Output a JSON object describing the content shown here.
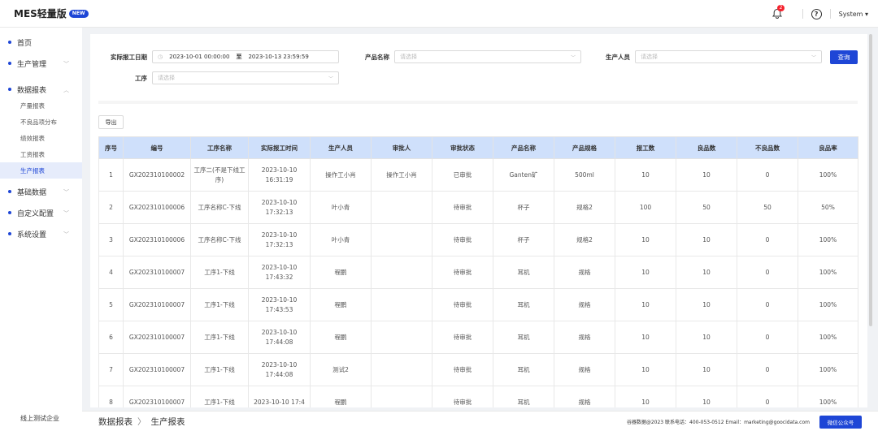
{
  "header": {
    "logo": "MES轻量版",
    "badge": "NEW",
    "notifications": "2",
    "user": "System ▾"
  },
  "sidebar": {
    "menu": [
      {
        "label": "首页"
      },
      {
        "label": "生产管理"
      },
      {
        "label": "数据报表"
      }
    ],
    "submenu": [
      "产量报表",
      "不良品项分布",
      "绩效报表",
      "工资报表",
      "生产报表"
    ],
    "menu2": [
      {
        "label": "基础数据"
      },
      {
        "label": "自定义配置"
      },
      {
        "label": "系统设置"
      }
    ],
    "company": "线上测试企业"
  },
  "filters": {
    "date_label": "实际报工日期",
    "date_start": "2023-10-01 00:00:00",
    "date_to": "至",
    "date_end": "2023-10-13 23:59:59",
    "product_label": "产品名称",
    "product_placeholder": "请选择",
    "person_label": "生产人员",
    "person_placeholder": "请选择",
    "process_label": "工序",
    "process_placeholder": "请选择",
    "search": "查询"
  },
  "export": "导出",
  "table": {
    "headers": [
      "序号",
      "编号",
      "工序名称",
      "实际报工时间",
      "生产人员",
      "审批人",
      "审批状态",
      "产品名称",
      "产品规格",
      "报工数",
      "良品数",
      "不良品数",
      "良品率"
    ],
    "rows": [
      [
        "1",
        "GX202310100002",
        "工序二(不是下线工序)",
        "2023-10-10 16:31:19",
        "操作工小肖",
        "操作工小肖",
        "已审批",
        "Ganten矿",
        "500ml",
        "10",
        "10",
        "0",
        "100%"
      ],
      [
        "2",
        "GX202310100006",
        "工序名称C-下线",
        "2023-10-10 17:32:13",
        "叶小青",
        "",
        "待审批",
        "杯子",
        "规格2",
        "100",
        "50",
        "50",
        "50%"
      ],
      [
        "3",
        "GX202310100006",
        "工序名称C-下线",
        "2023-10-10 17:32:13",
        "叶小青",
        "",
        "待审批",
        "杯子",
        "规格2",
        "10",
        "10",
        "0",
        "100%"
      ],
      [
        "4",
        "GX202310100007",
        "工序1-下线",
        "2023-10-10 17:43:32",
        "程鹏",
        "",
        "待审批",
        "耳机",
        "规格",
        "10",
        "10",
        "0",
        "100%"
      ],
      [
        "5",
        "GX202310100007",
        "工序1-下线",
        "2023-10-10 17:43:53",
        "程鹏",
        "",
        "待审批",
        "耳机",
        "规格",
        "10",
        "10",
        "0",
        "100%"
      ],
      [
        "6",
        "GX202310100007",
        "工序1-下线",
        "2023-10-10 17:44:08",
        "程鹏",
        "",
        "待审批",
        "耳机",
        "规格",
        "10",
        "10",
        "0",
        "100%"
      ],
      [
        "7",
        "GX202310100007",
        "工序1-下线",
        "2023-10-10 17:44:08",
        "测试2",
        "",
        "待审批",
        "耳机",
        "规格",
        "10",
        "10",
        "0",
        "100%"
      ],
      [
        "8",
        "GX202310100007",
        "工序1-下线",
        "2023-10-10 17:4",
        "程鹏",
        "",
        "待审批",
        "耳机",
        "规格",
        "10",
        "10",
        "0",
        "100%"
      ]
    ]
  },
  "footer": {
    "crumb1": "数据报表",
    "crumb2": "生产报表",
    "copyright": "谷器数据@2023 联系电话：400-053-0512 Email：marketing@goocidata.com",
    "wechat": "微信公众号"
  },
  "colors": {
    "primary": "#1e46d6",
    "header_bg": "#cfe0fb"
  }
}
